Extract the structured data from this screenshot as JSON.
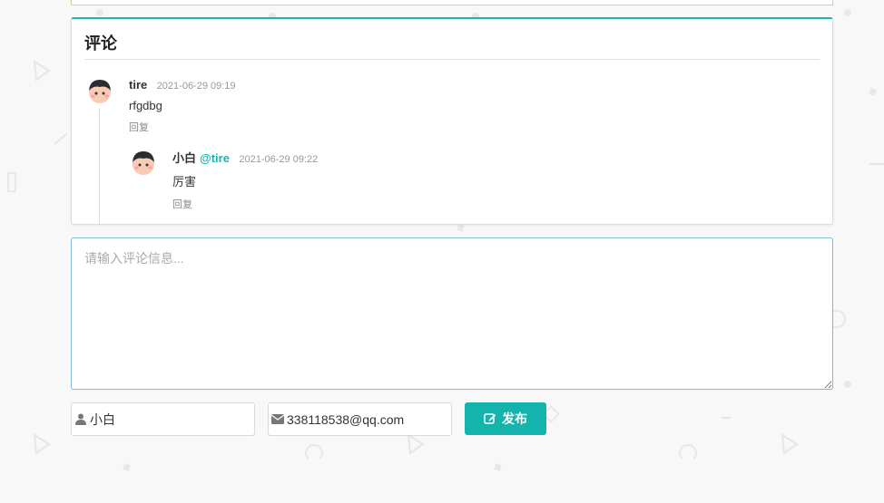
{
  "comments": {
    "title": "评论",
    "items": [
      {
        "author": "tire",
        "date": "2021-06-29 09:19",
        "text": "rfgdbg",
        "reply_label": "回复",
        "replies": [
          {
            "author": "小白",
            "at": "@tire",
            "date": "2021-06-29 09:22",
            "text": "厉害",
            "reply_label": "回复"
          }
        ]
      }
    ]
  },
  "form": {
    "textarea_placeholder": "请输入评论信息...",
    "name_value": "小白",
    "email_value": "338118538@qq.com",
    "submit_label": "发布",
    "icons": {
      "name": "user-icon",
      "email": "envelope-icon",
      "submit": "edit-icon"
    }
  },
  "colors": {
    "accent": "#14b4ad",
    "border_input": "#85b7d9"
  }
}
